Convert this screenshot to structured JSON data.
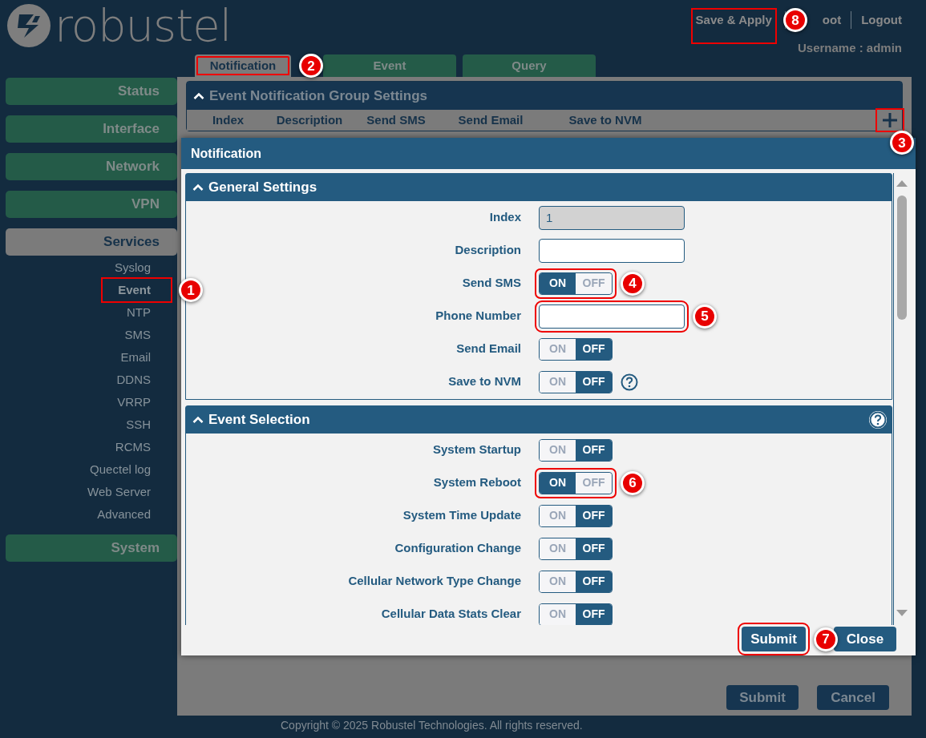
{
  "header": {
    "logo": "robustel",
    "links": [
      {
        "label": "Save & Apply",
        "callout": "8"
      },
      {
        "label": "oot"
      },
      {
        "label": "Logout"
      }
    ],
    "username": "Username : admin"
  },
  "sidebar": [
    {
      "label": "Status",
      "selected": false
    },
    {
      "label": "Interface",
      "selected": false
    },
    {
      "label": "Network",
      "selected": false
    },
    {
      "label": "VPN",
      "selected": false
    },
    {
      "label": "Services",
      "selected": true,
      "children": [
        {
          "label": "Syslog",
          "selected": false
        },
        {
          "label": "Event",
          "selected": true,
          "callout": "1"
        },
        {
          "label": "NTP",
          "selected": false
        },
        {
          "label": "SMS",
          "selected": false
        },
        {
          "label": "Email",
          "selected": false
        },
        {
          "label": "DDNS",
          "selected": false
        },
        {
          "label": "VRRP",
          "selected": false
        },
        {
          "label": "SSH",
          "selected": false
        },
        {
          "label": "RCMS",
          "selected": false
        },
        {
          "label": "Quectel log",
          "selected": false
        },
        {
          "label": "Web Server",
          "selected": false
        },
        {
          "label": "Advanced",
          "selected": false
        }
      ]
    },
    {
      "label": "System",
      "selected": false
    }
  ],
  "tabs": [
    {
      "label": "Notification",
      "selected": true,
      "callout": "2"
    },
    {
      "label": "Event",
      "selected": false
    },
    {
      "label": "Query",
      "selected": false
    }
  ],
  "group": {
    "title": "Event Notification Group Settings",
    "columns": [
      "Index",
      "Description",
      "Send SMS",
      "Send Email",
      "Save to NVM"
    ],
    "add_callout": "3"
  },
  "page_buttons": [
    "Submit",
    "Cancel"
  ],
  "footer": "Copyright © 2025 Robustel Technologies. All rights reserved.",
  "dialog": {
    "title": "Notification",
    "sections": [
      {
        "title": "General Settings",
        "help": false,
        "rows": [
          {
            "kind": "text",
            "label": "Index",
            "value": "1",
            "disabled": true
          },
          {
            "kind": "text",
            "label": "Description",
            "disabled": false
          },
          {
            "kind": "toggle",
            "label": "Send SMS",
            "on": true,
            "on_text": "ON",
            "off_text": "OFF",
            "callout": "4"
          },
          {
            "kind": "text",
            "label": "Phone Number",
            "disabled": false,
            "callout": "5"
          },
          {
            "kind": "toggle",
            "label": "Send Email",
            "on": false,
            "on_text": "ON",
            "off_text": "OFF"
          },
          {
            "kind": "toggle",
            "label": "Save to NVM",
            "on": false,
            "on_text": "ON",
            "off_text": "OFF",
            "help": true
          }
        ]
      },
      {
        "title": "Event Selection",
        "help": true,
        "rows": [
          {
            "kind": "toggle",
            "label": "System Startup",
            "on": false,
            "on_text": "ON",
            "off_text": "OFF"
          },
          {
            "kind": "toggle",
            "label": "System Reboot",
            "on": true,
            "on_text": "ON",
            "off_text": "OFF",
            "callout": "6"
          },
          {
            "kind": "toggle",
            "label": "System Time Update",
            "on": false,
            "on_text": "ON",
            "off_text": "OFF"
          },
          {
            "kind": "toggle",
            "label": "Configuration Change",
            "on": false,
            "on_text": "ON",
            "off_text": "OFF"
          },
          {
            "kind": "toggle",
            "label": "Cellular Network Type Change",
            "on": false,
            "on_text": "ON",
            "off_text": "OFF"
          },
          {
            "kind": "toggle",
            "label": "Cellular Data Stats Clear",
            "on": false,
            "on_text": "ON",
            "off_text": "OFF"
          }
        ]
      }
    ],
    "buttons": [
      {
        "label": "Submit",
        "callout": "7"
      },
      {
        "label": "Close"
      }
    ]
  }
}
